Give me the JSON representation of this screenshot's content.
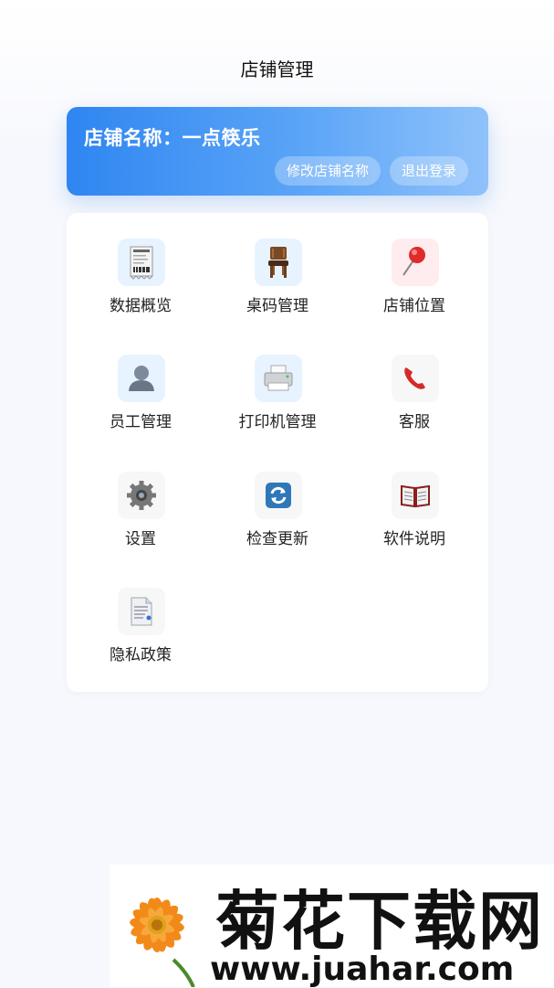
{
  "header": {
    "title": "店铺管理"
  },
  "store": {
    "name_label": "店铺名称：一点筷乐",
    "rename_button": "修改店铺名称",
    "logout_button": "退出登录"
  },
  "menu": [
    {
      "label": "数据概览",
      "icon": "receipt-icon"
    },
    {
      "label": "桌码管理",
      "icon": "chair-icon"
    },
    {
      "label": "店铺位置",
      "icon": "pushpin-icon"
    },
    {
      "label": "员工管理",
      "icon": "person-icon"
    },
    {
      "label": "打印机管理",
      "icon": "printer-icon"
    },
    {
      "label": "客服",
      "icon": "phone-icon"
    },
    {
      "label": "设置",
      "icon": "gear-icon"
    },
    {
      "label": "检查更新",
      "icon": "refresh-icon"
    },
    {
      "label": "软件说明",
      "icon": "book-icon"
    },
    {
      "label": "隐私政策",
      "icon": "document-icon"
    }
  ],
  "watermark": {
    "brand": "菊花下载网",
    "url": "www.juahar.com"
  },
  "colors": {
    "accent": "#2f86f1",
    "background": "#f6f8fd"
  }
}
